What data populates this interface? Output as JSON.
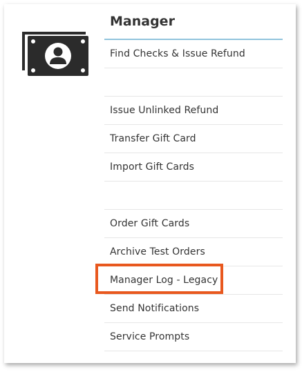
{
  "panel": {
    "title": "Manager",
    "icon": "cash-person-icon"
  },
  "menu": {
    "items": [
      {
        "label": "Find Checks & Issue Refund"
      },
      {
        "label": ""
      },
      {
        "label": "Issue Unlinked Refund"
      },
      {
        "label": "Transfer Gift Card"
      },
      {
        "label": "Import Gift Cards"
      },
      {
        "label": ""
      },
      {
        "label": "Order Gift Cards"
      },
      {
        "label": "Archive Test Orders"
      },
      {
        "label": "Manager Log - Legacy"
      },
      {
        "label": "Send Notifications"
      },
      {
        "label": "Service Prompts"
      }
    ]
  },
  "colors": {
    "accent_line": "#8fc3dc",
    "highlight": "#e8581e",
    "icon": "#2b2b2b"
  }
}
